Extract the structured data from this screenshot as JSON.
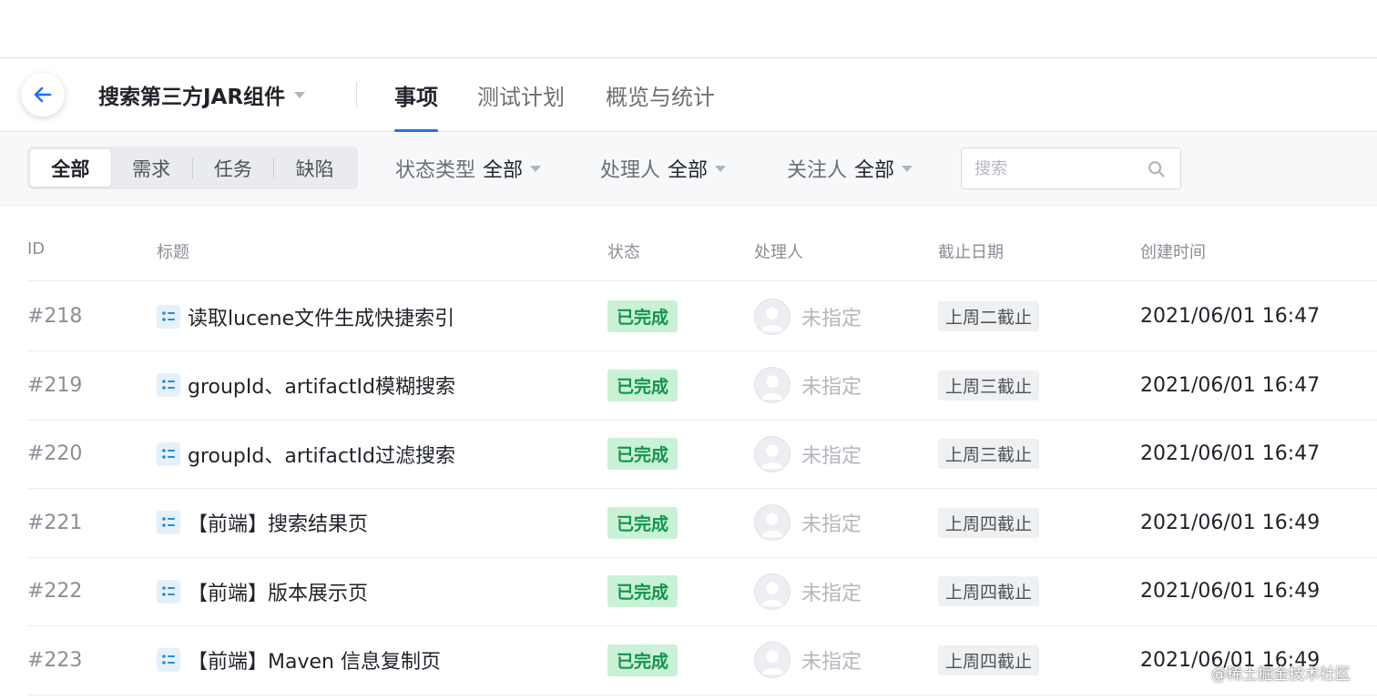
{
  "header": {
    "project_name": "搜索第三方JAR组件",
    "tabs": [
      {
        "label": "事项",
        "active": true
      },
      {
        "label": "测试计划",
        "active": false
      },
      {
        "label": "概览与统计",
        "active": false
      }
    ]
  },
  "filters": {
    "segments": [
      "全部",
      "需求",
      "任务",
      "缺陷"
    ],
    "active_segment": "全部",
    "status_type": {
      "label": "状态类型",
      "value": "全部"
    },
    "assignee": {
      "label": "处理人",
      "value": "全部"
    },
    "follower": {
      "label": "关注人",
      "value": "全部"
    },
    "search_placeholder": "搜索"
  },
  "table": {
    "columns": [
      "ID",
      "标题",
      "状态",
      "处理人",
      "截止日期",
      "创建时间"
    ],
    "rows": [
      {
        "id": "#218",
        "title": "读取lucene文件生成快捷索引",
        "status": "已完成",
        "assignee": "未指定",
        "due": "上周二截止",
        "created": "2021/06/01 16:47"
      },
      {
        "id": "#219",
        "title": "groupId、artifactId模糊搜索",
        "status": "已完成",
        "assignee": "未指定",
        "due": "上周三截止",
        "created": "2021/06/01 16:47"
      },
      {
        "id": "#220",
        "title": "groupId、artifactId过滤搜索",
        "status": "已完成",
        "assignee": "未指定",
        "due": "上周三截止",
        "created": "2021/06/01 16:47"
      },
      {
        "id": "#221",
        "title": "【前端】搜索结果页",
        "status": "已完成",
        "assignee": "未指定",
        "due": "上周四截止",
        "created": "2021/06/01 16:49"
      },
      {
        "id": "#222",
        "title": "【前端】版本展示页",
        "status": "已完成",
        "assignee": "未指定",
        "due": "上周四截止",
        "created": "2021/06/01 16:49"
      },
      {
        "id": "#223",
        "title": "【前端】Maven 信息复制页",
        "status": "已完成",
        "assignee": "未指定",
        "due": "上周四截止",
        "created": "2021/06/01 16:49"
      }
    ]
  },
  "watermark": "@稀土掘金技术社区",
  "colors": {
    "accent": "#1e6fff",
    "status_done_bg": "#c9f1d5",
    "status_done_text": "#13944d"
  }
}
